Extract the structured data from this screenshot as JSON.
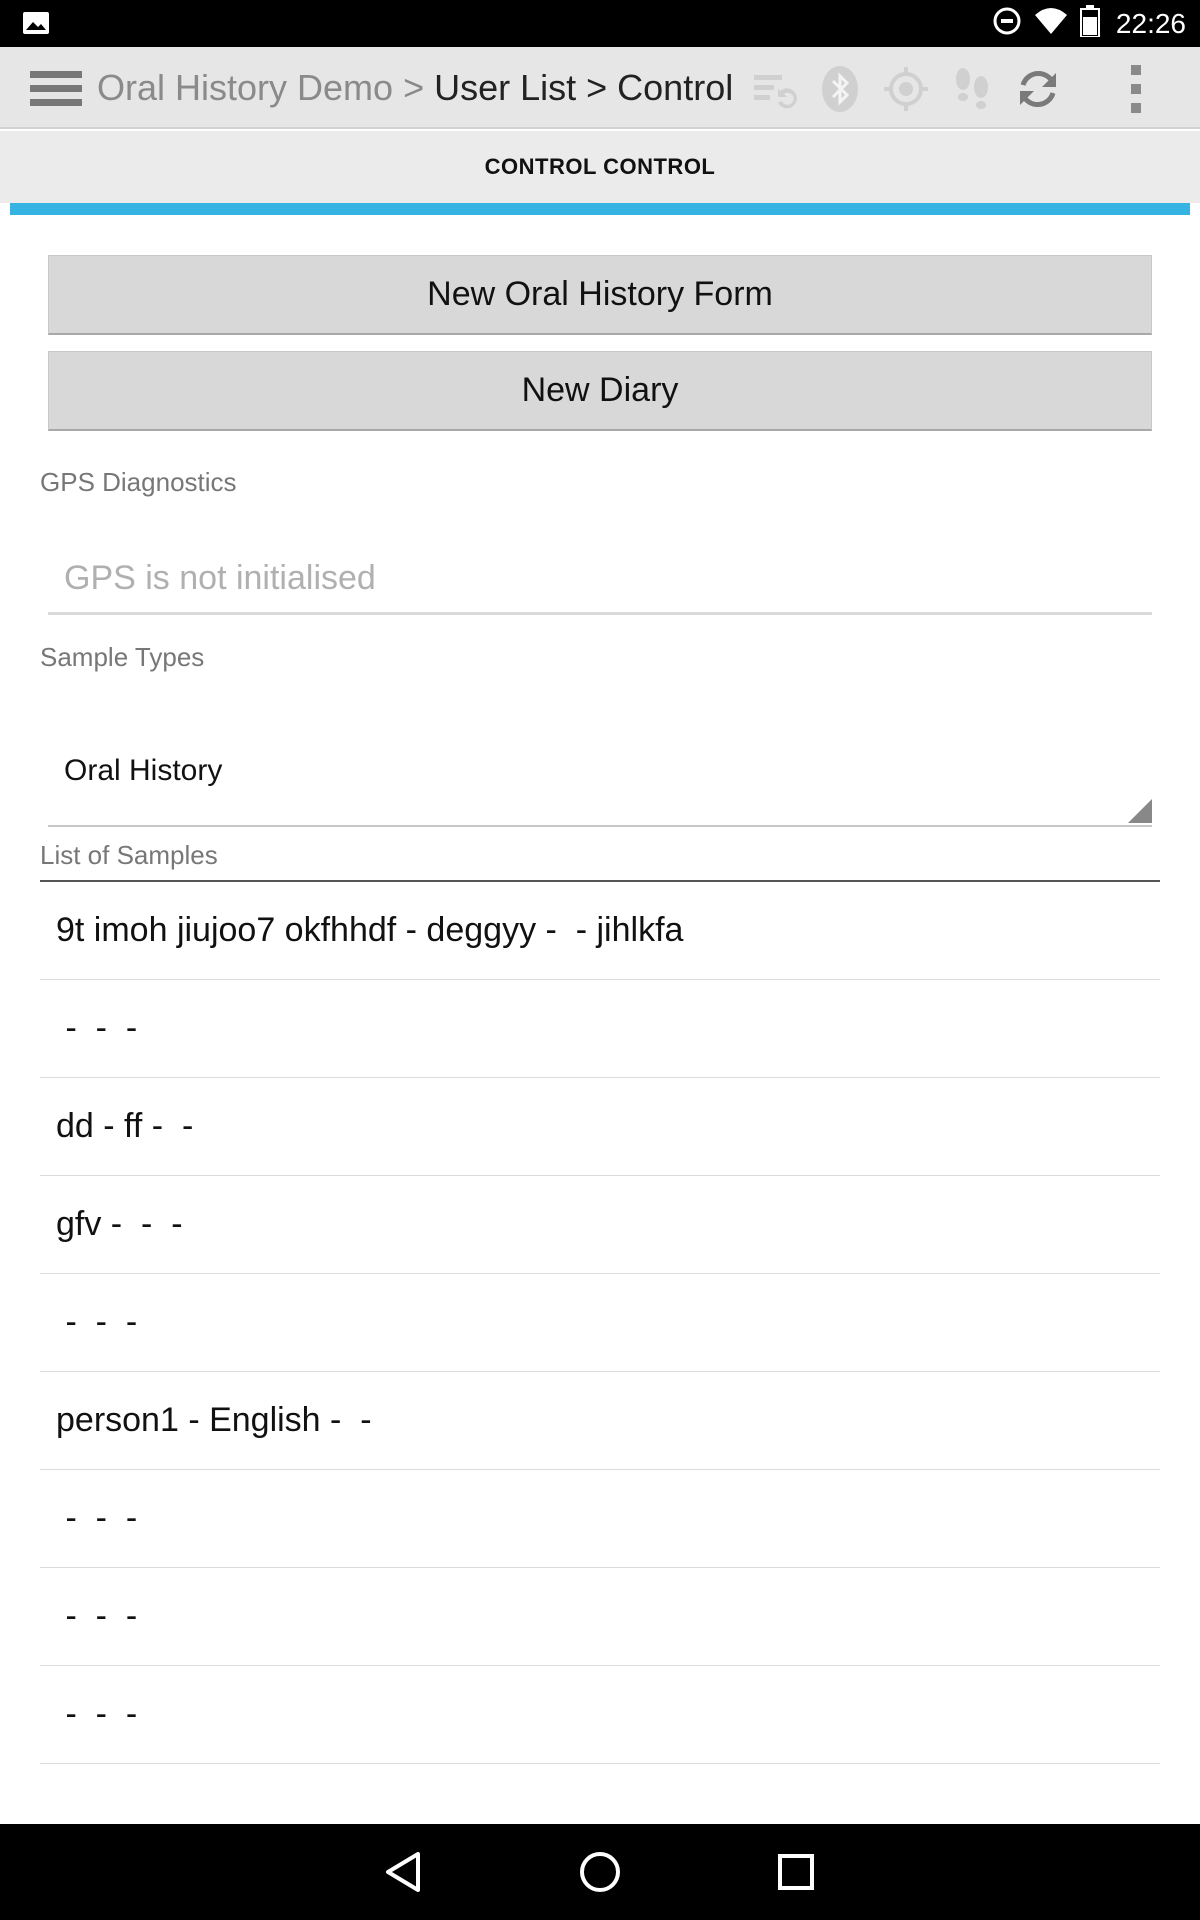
{
  "status_bar": {
    "time": "22:26",
    "icons": [
      "image-icon",
      "do-not-disturb-icon",
      "wifi-icon",
      "battery-icon"
    ]
  },
  "action_bar": {
    "breadcrumb": {
      "root": "Oral History Demo",
      "separator": ">",
      "items": [
        "User List",
        "Control"
      ]
    },
    "icons": [
      "hamburger-menu-icon",
      "sync-form-icon",
      "bluetooth-icon",
      "gps-target-icon",
      "footsteps-icon",
      "refresh-icon",
      "overflow-menu-icon"
    ]
  },
  "tab": {
    "label": "CONTROL CONTROL",
    "indicator_color": "#35b4e4"
  },
  "buttons": {
    "new_oral_history": "New Oral History Form",
    "new_diary": "New Diary"
  },
  "gps": {
    "label": "GPS Diagnostics",
    "placeholder": "GPS is not initialised",
    "value": ""
  },
  "sample_types": {
    "label": "Sample Types",
    "selected": "Oral History"
  },
  "samples": {
    "label": "List of Samples",
    "items": [
      "9t imoh jiujoo7 okfhhdf - deggyy -  - jihlkfa",
      " -  -  -",
      "dd - ff -  -",
      "gfv -  -  -",
      " -  -  -",
      "person1 - English -  -",
      " -  -  -",
      " -  -  -",
      " -  -  -"
    ]
  },
  "nav_bar": {
    "icons": [
      "back-icon",
      "home-icon",
      "recents-icon"
    ]
  }
}
